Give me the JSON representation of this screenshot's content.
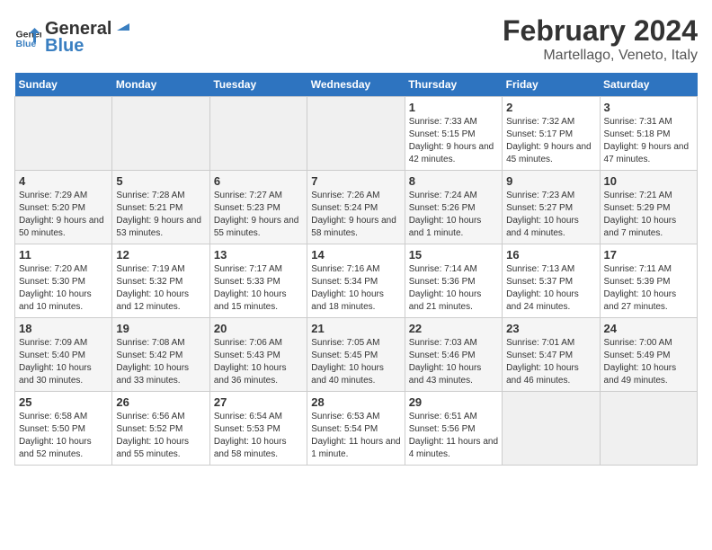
{
  "logo": {
    "text_general": "General",
    "text_blue": "Blue"
  },
  "title": "February 2024",
  "subtitle": "Martellago, Veneto, Italy",
  "days_of_week": [
    "Sunday",
    "Monday",
    "Tuesday",
    "Wednesday",
    "Thursday",
    "Friday",
    "Saturday"
  ],
  "weeks": [
    [
      {
        "day": "",
        "sunrise": "",
        "sunset": "",
        "daylight": "",
        "empty": true
      },
      {
        "day": "",
        "sunrise": "",
        "sunset": "",
        "daylight": "",
        "empty": true
      },
      {
        "day": "",
        "sunrise": "",
        "sunset": "",
        "daylight": "",
        "empty": true
      },
      {
        "day": "",
        "sunrise": "",
        "sunset": "",
        "daylight": "",
        "empty": true
      },
      {
        "day": "1",
        "sunrise": "Sunrise: 7:33 AM",
        "sunset": "Sunset: 5:15 PM",
        "daylight": "Daylight: 9 hours and 42 minutes.",
        "empty": false
      },
      {
        "day": "2",
        "sunrise": "Sunrise: 7:32 AM",
        "sunset": "Sunset: 5:17 PM",
        "daylight": "Daylight: 9 hours and 45 minutes.",
        "empty": false
      },
      {
        "day": "3",
        "sunrise": "Sunrise: 7:31 AM",
        "sunset": "Sunset: 5:18 PM",
        "daylight": "Daylight: 9 hours and 47 minutes.",
        "empty": false
      }
    ],
    [
      {
        "day": "4",
        "sunrise": "Sunrise: 7:29 AM",
        "sunset": "Sunset: 5:20 PM",
        "daylight": "Daylight: 9 hours and 50 minutes.",
        "empty": false
      },
      {
        "day": "5",
        "sunrise": "Sunrise: 7:28 AM",
        "sunset": "Sunset: 5:21 PM",
        "daylight": "Daylight: 9 hours and 53 minutes.",
        "empty": false
      },
      {
        "day": "6",
        "sunrise": "Sunrise: 7:27 AM",
        "sunset": "Sunset: 5:23 PM",
        "daylight": "Daylight: 9 hours and 55 minutes.",
        "empty": false
      },
      {
        "day": "7",
        "sunrise": "Sunrise: 7:26 AM",
        "sunset": "Sunset: 5:24 PM",
        "daylight": "Daylight: 9 hours and 58 minutes.",
        "empty": false
      },
      {
        "day": "8",
        "sunrise": "Sunrise: 7:24 AM",
        "sunset": "Sunset: 5:26 PM",
        "daylight": "Daylight: 10 hours and 1 minute.",
        "empty": false
      },
      {
        "day": "9",
        "sunrise": "Sunrise: 7:23 AM",
        "sunset": "Sunset: 5:27 PM",
        "daylight": "Daylight: 10 hours and 4 minutes.",
        "empty": false
      },
      {
        "day": "10",
        "sunrise": "Sunrise: 7:21 AM",
        "sunset": "Sunset: 5:29 PM",
        "daylight": "Daylight: 10 hours and 7 minutes.",
        "empty": false
      }
    ],
    [
      {
        "day": "11",
        "sunrise": "Sunrise: 7:20 AM",
        "sunset": "Sunset: 5:30 PM",
        "daylight": "Daylight: 10 hours and 10 minutes.",
        "empty": false
      },
      {
        "day": "12",
        "sunrise": "Sunrise: 7:19 AM",
        "sunset": "Sunset: 5:32 PM",
        "daylight": "Daylight: 10 hours and 12 minutes.",
        "empty": false
      },
      {
        "day": "13",
        "sunrise": "Sunrise: 7:17 AM",
        "sunset": "Sunset: 5:33 PM",
        "daylight": "Daylight: 10 hours and 15 minutes.",
        "empty": false
      },
      {
        "day": "14",
        "sunrise": "Sunrise: 7:16 AM",
        "sunset": "Sunset: 5:34 PM",
        "daylight": "Daylight: 10 hours and 18 minutes.",
        "empty": false
      },
      {
        "day": "15",
        "sunrise": "Sunrise: 7:14 AM",
        "sunset": "Sunset: 5:36 PM",
        "daylight": "Daylight: 10 hours and 21 minutes.",
        "empty": false
      },
      {
        "day": "16",
        "sunrise": "Sunrise: 7:13 AM",
        "sunset": "Sunset: 5:37 PM",
        "daylight": "Daylight: 10 hours and 24 minutes.",
        "empty": false
      },
      {
        "day": "17",
        "sunrise": "Sunrise: 7:11 AM",
        "sunset": "Sunset: 5:39 PM",
        "daylight": "Daylight: 10 hours and 27 minutes.",
        "empty": false
      }
    ],
    [
      {
        "day": "18",
        "sunrise": "Sunrise: 7:09 AM",
        "sunset": "Sunset: 5:40 PM",
        "daylight": "Daylight: 10 hours and 30 minutes.",
        "empty": false
      },
      {
        "day": "19",
        "sunrise": "Sunrise: 7:08 AM",
        "sunset": "Sunset: 5:42 PM",
        "daylight": "Daylight: 10 hours and 33 minutes.",
        "empty": false
      },
      {
        "day": "20",
        "sunrise": "Sunrise: 7:06 AM",
        "sunset": "Sunset: 5:43 PM",
        "daylight": "Daylight: 10 hours and 36 minutes.",
        "empty": false
      },
      {
        "day": "21",
        "sunrise": "Sunrise: 7:05 AM",
        "sunset": "Sunset: 5:45 PM",
        "daylight": "Daylight: 10 hours and 40 minutes.",
        "empty": false
      },
      {
        "day": "22",
        "sunrise": "Sunrise: 7:03 AM",
        "sunset": "Sunset: 5:46 PM",
        "daylight": "Daylight: 10 hours and 43 minutes.",
        "empty": false
      },
      {
        "day": "23",
        "sunrise": "Sunrise: 7:01 AM",
        "sunset": "Sunset: 5:47 PM",
        "daylight": "Daylight: 10 hours and 46 minutes.",
        "empty": false
      },
      {
        "day": "24",
        "sunrise": "Sunrise: 7:00 AM",
        "sunset": "Sunset: 5:49 PM",
        "daylight": "Daylight: 10 hours and 49 minutes.",
        "empty": false
      }
    ],
    [
      {
        "day": "25",
        "sunrise": "Sunrise: 6:58 AM",
        "sunset": "Sunset: 5:50 PM",
        "daylight": "Daylight: 10 hours and 52 minutes.",
        "empty": false
      },
      {
        "day": "26",
        "sunrise": "Sunrise: 6:56 AM",
        "sunset": "Sunset: 5:52 PM",
        "daylight": "Daylight: 10 hours and 55 minutes.",
        "empty": false
      },
      {
        "day": "27",
        "sunrise": "Sunrise: 6:54 AM",
        "sunset": "Sunset: 5:53 PM",
        "daylight": "Daylight: 10 hours and 58 minutes.",
        "empty": false
      },
      {
        "day": "28",
        "sunrise": "Sunrise: 6:53 AM",
        "sunset": "Sunset: 5:54 PM",
        "daylight": "Daylight: 11 hours and 1 minute.",
        "empty": false
      },
      {
        "day": "29",
        "sunrise": "Sunrise: 6:51 AM",
        "sunset": "Sunset: 5:56 PM",
        "daylight": "Daylight: 11 hours and 4 minutes.",
        "empty": false
      },
      {
        "day": "",
        "sunrise": "",
        "sunset": "",
        "daylight": "",
        "empty": true
      },
      {
        "day": "",
        "sunrise": "",
        "sunset": "",
        "daylight": "",
        "empty": true
      }
    ]
  ]
}
